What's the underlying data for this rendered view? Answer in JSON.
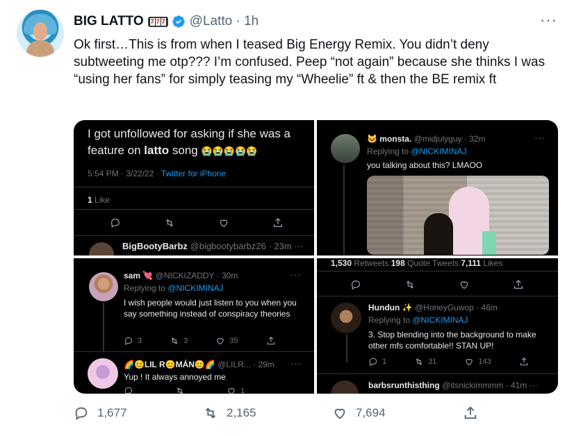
{
  "tweet": {
    "name": "BIG LATTO",
    "name_emoji": [
      "7",
      "7",
      "7"
    ],
    "handle": "@Latto",
    "time": "· 1h",
    "more": "···",
    "text": "Ok first…This is from when I teased Big Energy Remix. You didn’t deny subtweeting me otp??? I’m confused. Peep “not again” because she thinks I was “using her fans” for simply teasing my “Wheelie” ft & then the BE remix ft",
    "stats": {
      "replies": "1,677",
      "retweets": "2,165",
      "likes": "7,694"
    }
  },
  "pane1": {
    "text_a": "I got unfollowed for asking if she was a",
    "text_b": "feature on ",
    "text_bold": "latto",
    "text_c": " song",
    "emojis": "😭😭😭😭😭",
    "meta_time": "5:54 PM · 3/22/22 · ",
    "meta_source": "Twitter for iPhone",
    "likes_count": "1",
    "likes_label": " Like",
    "reply_name": "BigBootyBarbz",
    "reply_handle": "@bigbootybarbz26 · 23m",
    "more": "···"
  },
  "pane2": {
    "name": "monsta.",
    "handle": "@midjulyguy · 32m",
    "replying_prefix": "Replying to ",
    "replying_to": "@NICKIMINAJ",
    "text": "you talking about this? LMAOO",
    "retweets_count": "1,530",
    "retweets_label": " Retweets",
    "quotes_count": "198",
    "quotes_label": " Quote Tweets",
    "likes_count": "7,111",
    "likes_label": " Likes",
    "more": "···"
  },
  "pane3": {
    "name": "sam",
    "name_emoji": "💘",
    "handle": "@NICKIZADDY · 30m",
    "replying_prefix": "Replying to ",
    "replying_to": "@NICKIMINAJ",
    "text": "I wish people would just listen to you when you say something instead of conspiracy theories",
    "replies": "3",
    "retweets": "3",
    "likes": "35",
    "reply2_name": "🌈😊LIL R😊MÁN😊🌈",
    "reply2_handle": "@LILR... · 29m",
    "reply2_text": "Yup ! It always annoyed me",
    "reply2_likes": "1",
    "more": "···"
  },
  "pane4": {
    "name": "Hundun",
    "name_emoji": "✨",
    "handle": "@HoneyGuwop · 46m",
    "replying_prefix": "Replying to ",
    "replying_to": "@NICKIMINAJ",
    "text": "3. Stop blending into the background to make other mfs comfortable!! STAN UP!",
    "replies": "1",
    "retweets": "31",
    "likes": "143",
    "reply2_name": "barbsrunthisthing",
    "reply2_handle": "@itsnickimmmm · 41m",
    "more": "···"
  }
}
